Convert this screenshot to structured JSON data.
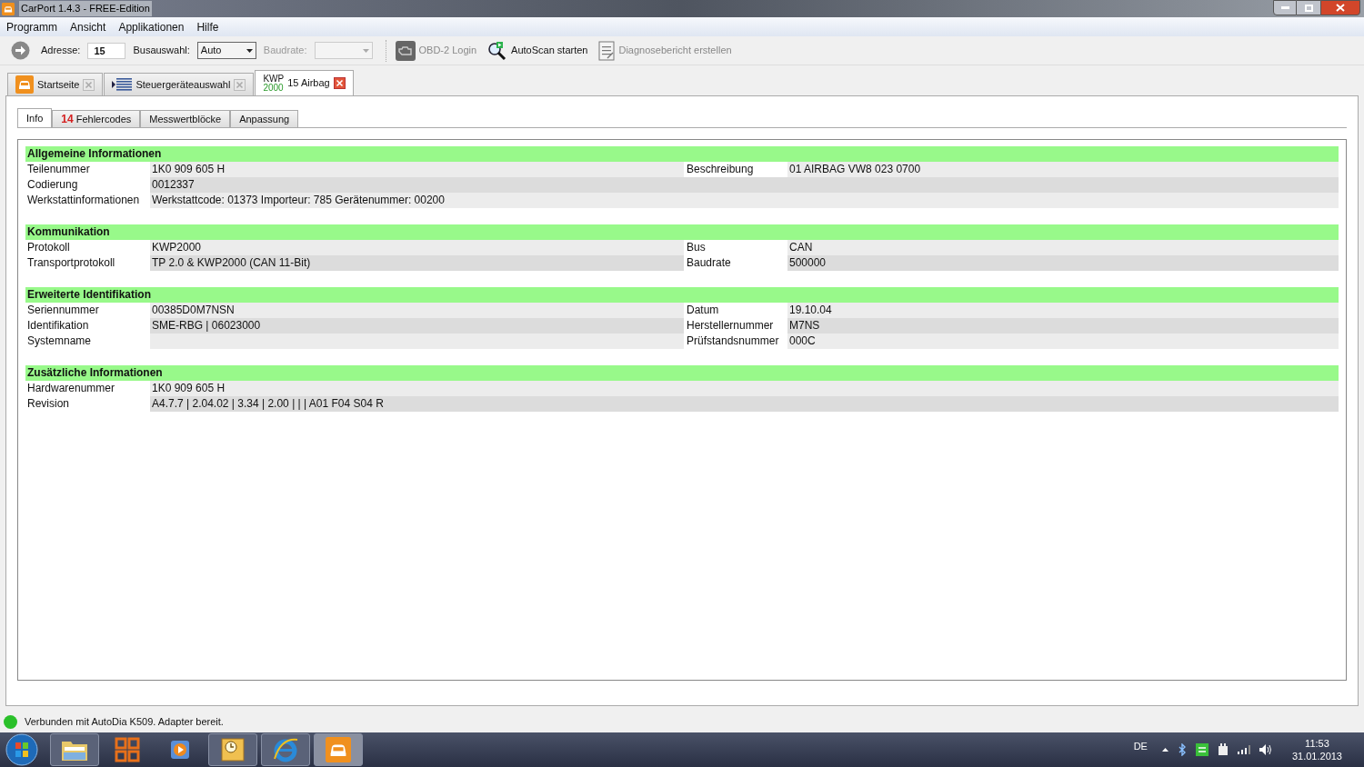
{
  "window": {
    "title": "CarPort 1.4.3  - FREE-Edition"
  },
  "menu": [
    "Programm",
    "Ansicht",
    "Applikationen",
    "Hilfe"
  ],
  "toolbar": {
    "address_label": "Adresse:",
    "address_value": "15",
    "bus_label": "Busauswahl:",
    "bus_value": "Auto",
    "baud_label": "Baudrate:",
    "baud_disabled": true,
    "buttons": [
      {
        "kind": "engine",
        "label": "OBD-2 Login",
        "disabled": true
      },
      {
        "kind": "scan",
        "label": "AutoScan starten",
        "disabled": false
      },
      {
        "kind": "report",
        "label": "Diagnosebericht erstellen",
        "disabled": true
      }
    ]
  },
  "tabs": [
    {
      "kind": "home",
      "label": "Startseite",
      "selected": false
    },
    {
      "kind": "list",
      "label": "Steuergeräteauswahl",
      "selected": false
    },
    {
      "kind": "module",
      "protocol": "KWP",
      "protocol_version": "2000",
      "label": "15 Airbag",
      "selected": true
    }
  ],
  "subtabs": [
    {
      "label": "Info",
      "selected": true
    },
    {
      "count": "14",
      "label": "Fehlercodes",
      "selected": false
    },
    {
      "label": "Messwertblöcke",
      "selected": false
    },
    {
      "label": "Anpassung",
      "selected": false
    }
  ],
  "sections": [
    {
      "title": "Allgemeine Informationen",
      "rows": [
        {
          "label": "Teilenummer",
          "value": "1K0 909 605 H",
          "right_label": "Beschreibung",
          "right_value": "01 AIRBAG VW8  023 0700"
        },
        {
          "label": "Codierung",
          "value": "0012337"
        },
        {
          "label": "Werkstattinformationen",
          "value": "Werkstattcode: 01373  Importeur: 785  Gerätenummer: 00200"
        }
      ]
    },
    {
      "title": "Kommunikation",
      "rows": [
        {
          "label": "Protokoll",
          "value": "KWP2000",
          "right_label": "Bus",
          "right_value": "CAN"
        },
        {
          "label": "Transportprotokoll",
          "value": "TP 2.0 & KWP2000 (CAN 11-Bit)",
          "right_label": "Baudrate",
          "right_value": "500000"
        }
      ]
    },
    {
      "title": "Erweiterte Identifikation",
      "rows": [
        {
          "label": "Seriennummer",
          "value": "00385D0M7NSN",
          "right_label": "Datum",
          "right_value": "19.10.04"
        },
        {
          "label": "Identifikation",
          "value": "SME-RBG | 06023000",
          "right_label": "Herstellernummer",
          "right_value": "M7NS"
        },
        {
          "label": "Systemname",
          "right_label": "Prüfstandsnummer",
          "right_value": "000C"
        }
      ]
    },
    {
      "title": "Zusätzliche Informationen",
      "rows": [
        {
          "label": "Hardwarenummer",
          "value": "1K0 909 605 H"
        },
        {
          "label": "Revision",
          "value": "A4.7.7 | 2.04.02 | 3.34 | 2.00 |     |     | A01 F04 S04 R"
        }
      ]
    }
  ],
  "status_bar": {
    "connected": true,
    "text": "Verbunden mit AutoDia K509. Adapter bereit."
  },
  "taskbar": {
    "apps": [
      {
        "kind": "folder",
        "running": true,
        "selected": false
      },
      {
        "kind": "office",
        "running": false,
        "selected": false
      },
      {
        "kind": "media",
        "running": false,
        "selected": false
      },
      {
        "kind": "clock",
        "running": true,
        "selected": false
      },
      {
        "kind": "browser",
        "running": true,
        "selected": false
      },
      {
        "kind": "car",
        "running": true,
        "selected": true
      }
    ],
    "language": "DE",
    "time": "11:53",
    "date": "31.01.2013"
  }
}
